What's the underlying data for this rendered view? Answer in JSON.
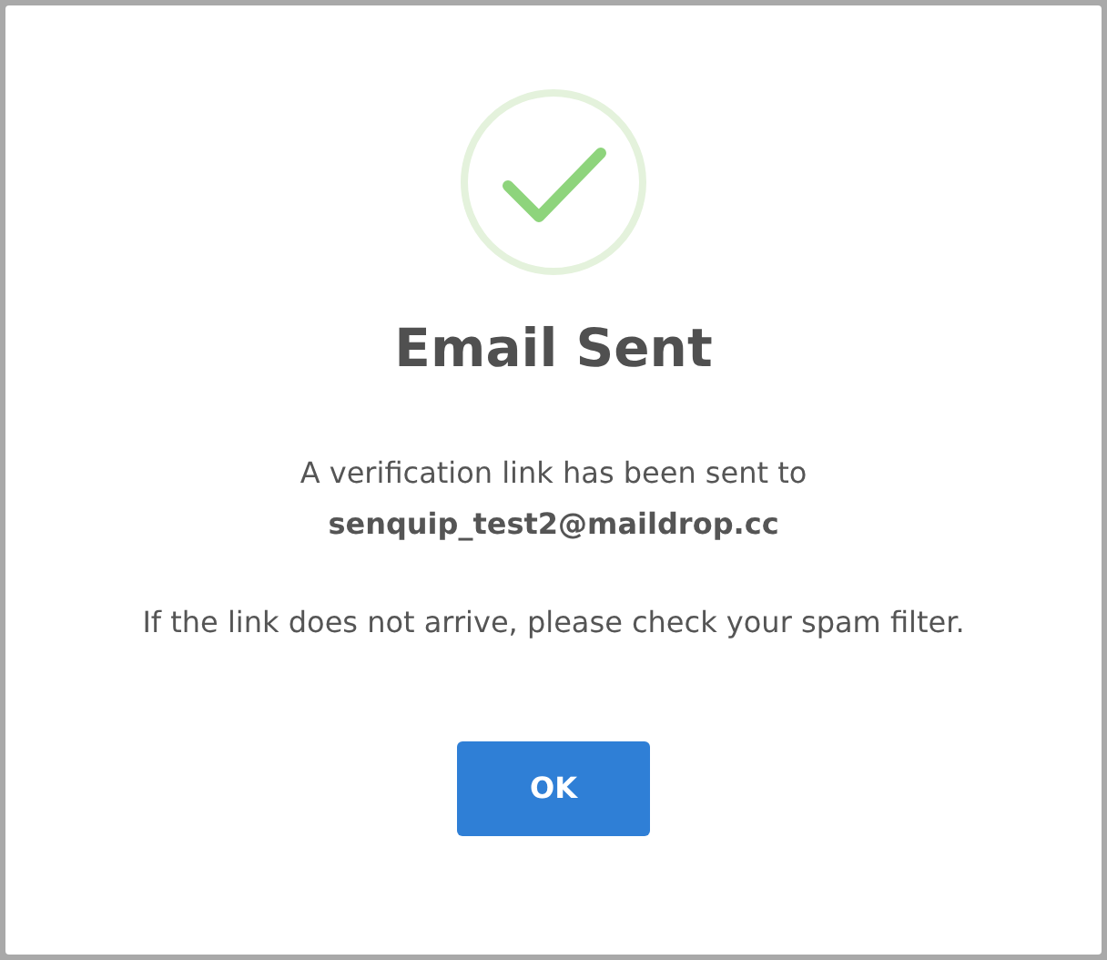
{
  "dialog": {
    "title": "Email Sent",
    "message": "A verification link has been sent to",
    "email": "senquip_test2@maildrop.cc",
    "note": "If the link does not arrive, please check your spam filter.",
    "buttons": [
      "OK"
    ]
  }
}
